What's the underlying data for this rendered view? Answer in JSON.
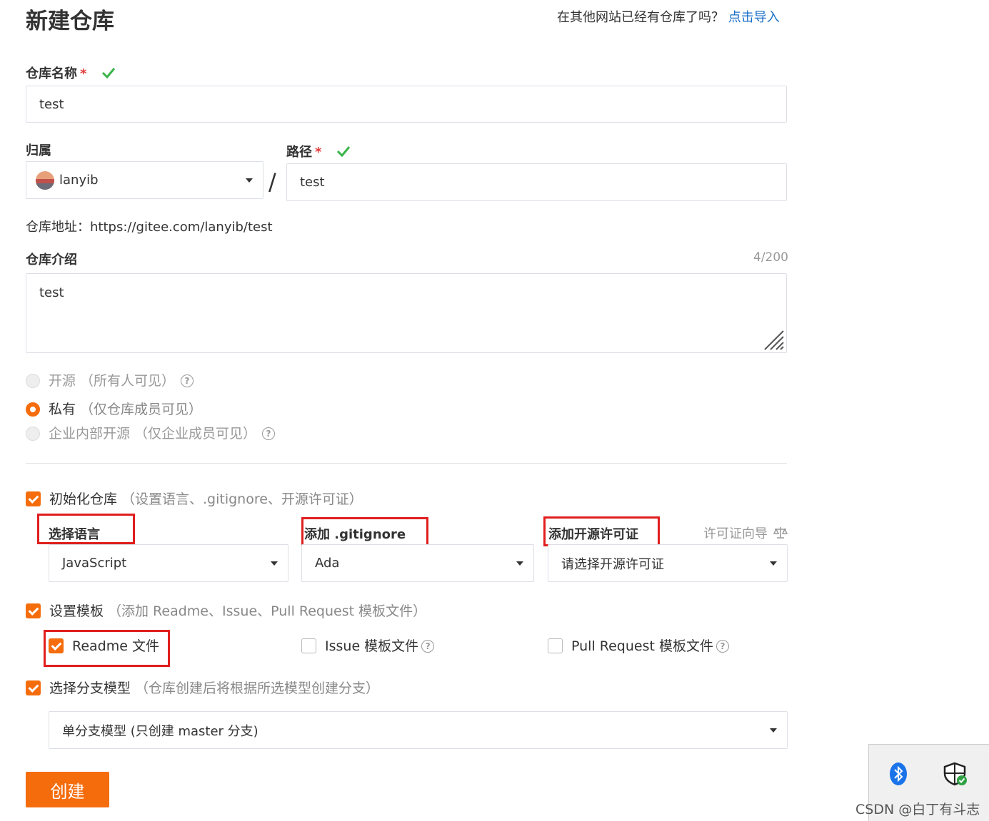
{
  "page": {
    "title": "新建仓库"
  },
  "import_hint": {
    "text": "在其他网站已经有仓库了吗？",
    "link": "点击导入"
  },
  "repo_name": {
    "label": "仓库名称",
    "required_mark": "*",
    "value": "test"
  },
  "owner": {
    "label": "归属",
    "value": "lanyib"
  },
  "separator": "/",
  "path": {
    "label": "路径",
    "required_mark": "*",
    "value": "test"
  },
  "repo_url": {
    "label": "仓库地址：",
    "value": "https://gitee.com/lanyib/test"
  },
  "description": {
    "label": "仓库介绍",
    "counter": "4/200",
    "value": "test"
  },
  "visibility": {
    "options": [
      {
        "label": "开源",
        "hint": "（所有人可见）",
        "selected": false,
        "disabled": true,
        "has_help": true
      },
      {
        "label": "私有",
        "hint": "（仅仓库成员可见）",
        "selected": true,
        "disabled": false,
        "has_help": false
      },
      {
        "label": "企业内部开源",
        "hint": "（仅企业成员可见）",
        "selected": false,
        "disabled": true,
        "has_help": true
      }
    ]
  },
  "init_repo": {
    "checked": true,
    "label": "初始化仓库",
    "hint": "（设置语言、.gitignore、开源许可证）",
    "language": {
      "label": "选择语言",
      "value": "JavaScript"
    },
    "gitignore": {
      "label": "添加 .gitignore",
      "value": "Ada"
    },
    "license": {
      "label": "添加开源许可证",
      "value": "请选择开源许可证",
      "guide": "许可证向导",
      "guide_icon": "scale-icon"
    }
  },
  "templates": {
    "checked": true,
    "label": "设置模板",
    "hint": "（添加 Readme、Issue、Pull Request 模板文件）",
    "readme": {
      "label": "Readme 文件",
      "checked": true
    },
    "issue": {
      "label": "Issue 模板文件",
      "checked": false
    },
    "pull_request": {
      "label": "Pull Request 模板文件",
      "checked": false
    }
  },
  "branch_model": {
    "checked": true,
    "label": "选择分支模型",
    "hint": "（仓库创建后将根据所选模型创建分支）",
    "value": "单分支模型 (只创建 master 分支)"
  },
  "create_button": {
    "label": "创建"
  },
  "watermark": "CSDN @白丁有斗志",
  "help_glyph": "?",
  "colors": {
    "accent": "#f56c0c",
    "link": "#1a6fc7",
    "check": "#3bb54a",
    "highlight": "#e01e1e"
  }
}
